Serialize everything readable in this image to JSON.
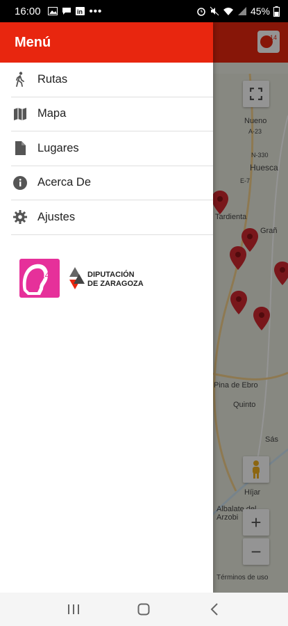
{
  "status_bar": {
    "time": "16:00",
    "battery": "45%",
    "more": "•••"
  },
  "drawer": {
    "title": "Menú",
    "items": [
      {
        "label": "Rutas",
        "icon": "walk-icon"
      },
      {
        "label": "Mapa",
        "icon": "map-icon"
      },
      {
        "label": "Lugares",
        "icon": "file-icon"
      },
      {
        "label": "Acerca De",
        "icon": "info-icon"
      },
      {
        "label": "Ajustes",
        "icon": "settings-gear-icon"
      }
    ],
    "sponsor_logo_text": "DIPUTACIÓN DE ZARAGOZA"
  },
  "map": {
    "labels": [
      "Nueno",
      "A-23",
      "N-330",
      "Huesca",
      "E-7",
      "Tardienta",
      "Grañ",
      "Pina de Ebro",
      "Quinto",
      "Sás",
      "Híjar",
      "Albalate del Arzobi",
      "Términos de uso"
    ],
    "zoom_in": "+",
    "zoom_out": "−"
  },
  "colors": {
    "accent": "#e8260f",
    "pin": "#d0282f"
  }
}
